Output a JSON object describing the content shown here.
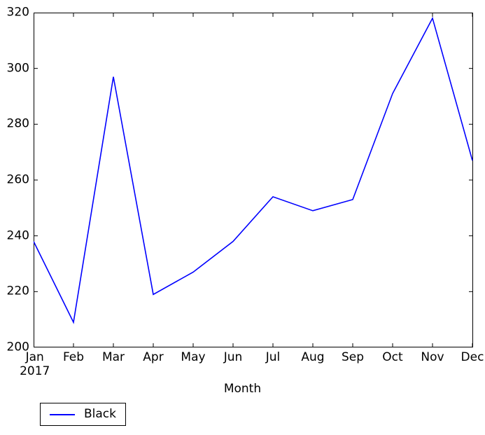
{
  "chart_data": {
    "type": "line",
    "title": "",
    "xlabel": "Month",
    "ylabel": "",
    "categories": [
      "Jan",
      "Feb",
      "Mar",
      "Apr",
      "May",
      "Jun",
      "Jul",
      "Aug",
      "Sep",
      "Oct",
      "Nov",
      "Dec"
    ],
    "x_sub_label": "2017",
    "series": [
      {
        "name": "Black",
        "color": "#0000ff",
        "values": [
          238,
          209,
          297,
          219,
          227,
          238,
          254,
          249,
          253,
          291,
          318,
          267
        ]
      }
    ],
    "ylim": [
      200,
      320
    ],
    "yticks": [
      200,
      220,
      240,
      260,
      280,
      300,
      320
    ],
    "ytick_labels": [
      "200",
      "220",
      "240",
      "260",
      "280",
      "300",
      "320"
    ],
    "grid": false,
    "legend_position": "below-left",
    "legend_entries": [
      "Black"
    ]
  },
  "axis": {
    "x_title": "Month",
    "y_title": ""
  },
  "legend": {
    "items": [
      {
        "label": "Black",
        "color": "#0000ff"
      }
    ]
  },
  "colors": {
    "line": "#0000ff",
    "axis": "#000000",
    "background": "#ffffff"
  }
}
